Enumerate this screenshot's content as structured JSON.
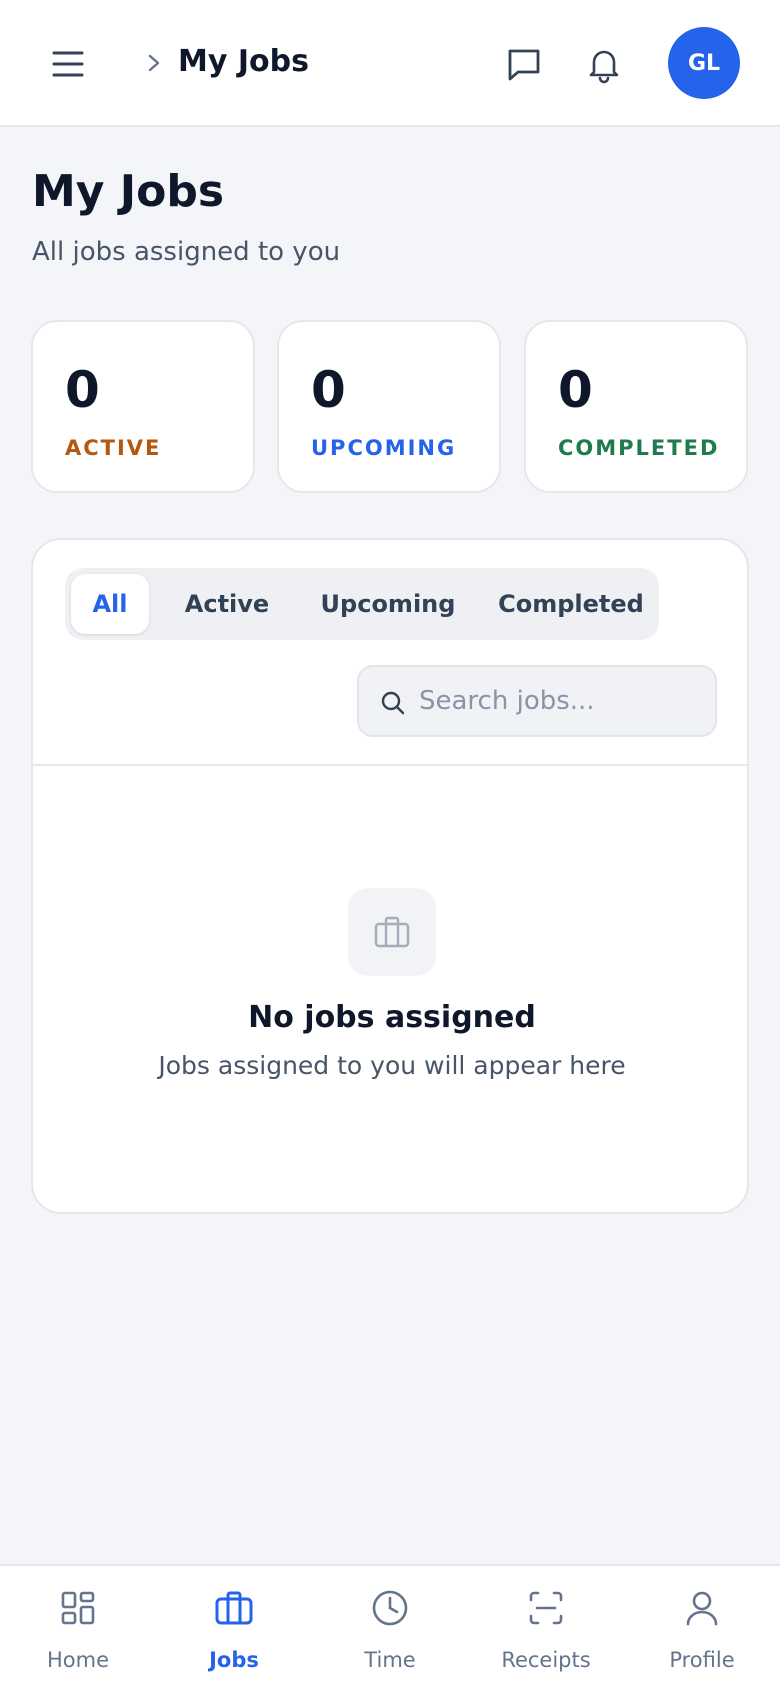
{
  "header": {
    "breadcrumb": "My Jobs",
    "avatar_initials": "GL",
    "icons": [
      "menu-icon",
      "chevron-right-icon",
      "message-icon",
      "bell-icon"
    ]
  },
  "page": {
    "title": "My Jobs",
    "subtitle": "All jobs assigned to you"
  },
  "stats": [
    {
      "value": "0",
      "label": "ACTIVE",
      "color": "#b4570f"
    },
    {
      "value": "0",
      "label": "UPCOMING",
      "color": "#2563eb"
    },
    {
      "value": "0",
      "label": "COMPLETED",
      "color": "#1f7a4f"
    }
  ],
  "tabs": [
    {
      "label": "All",
      "selected": true
    },
    {
      "label": "Active",
      "selected": false
    },
    {
      "label": "Upcoming",
      "selected": false
    },
    {
      "label": "Completed",
      "selected": false
    }
  ],
  "search": {
    "value": "",
    "placeholder": "Search jobs..."
  },
  "empty_state": {
    "icon": "briefcase-icon",
    "title": "No jobs assigned",
    "subtitle": "Jobs assigned to you will appear here"
  },
  "bottom_nav": [
    {
      "label": "Home",
      "icon": "grid-icon",
      "active": false
    },
    {
      "label": "Jobs",
      "icon": "briefcase-icon",
      "active": true
    },
    {
      "label": "Time",
      "icon": "clock-icon",
      "active": false
    },
    {
      "label": "Receipts",
      "icon": "scan-icon",
      "active": false
    },
    {
      "label": "Profile",
      "icon": "user-icon",
      "active": false
    }
  ],
  "colors": {
    "accent": "#2563eb",
    "background": "#f4f5f8"
  }
}
